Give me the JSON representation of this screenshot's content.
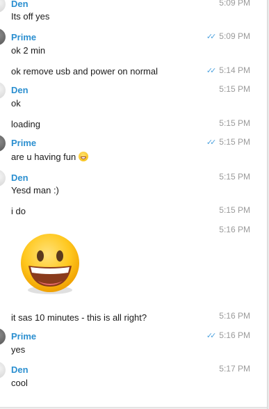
{
  "messages": [
    {
      "sender": "Den",
      "time": "5:09 PM",
      "text": "Its off yes",
      "read": false
    },
    {
      "sender": "Prime",
      "time": "5:09 PM",
      "text": "ok 2 min",
      "read": true
    },
    {
      "sender": "",
      "time": "5:14 PM",
      "text": "ok remove usb and power on normal",
      "read": true
    },
    {
      "sender": "Den",
      "time": "5:15 PM",
      "text": "ok",
      "read": false
    },
    {
      "sender": "",
      "time": "5:15 PM",
      "text": "loading",
      "read": false
    },
    {
      "sender": "Prime",
      "time": "5:15 PM",
      "text": "are u having fun",
      "emoji": "grinning-face-icon",
      "read": true
    },
    {
      "sender": "Den",
      "time": "5:15 PM",
      "text": "Yesd man :)",
      "read": false
    },
    {
      "sender": "",
      "time": "5:15 PM",
      "text": "i do",
      "read": false
    },
    {
      "sender": "",
      "time": "5:16 PM",
      "sticker": "grinning-face-sticker",
      "read": false
    },
    {
      "sender": "",
      "time": "5:16 PM",
      "text": "it sas 10 minutes - this is all right?",
      "read": false
    },
    {
      "sender": "Prime",
      "time": "5:16 PM",
      "text": "yes",
      "read": true
    },
    {
      "sender": "Den",
      "time": "5:17 PM",
      "text": "cool",
      "read": false
    }
  ],
  "colors": {
    "sender_name": "#2b8fd0",
    "read_ticks": "#4ea3df",
    "timestamp": "#9a9a9a",
    "message_text": "#1a1a1a",
    "background": "#ffffff"
  }
}
